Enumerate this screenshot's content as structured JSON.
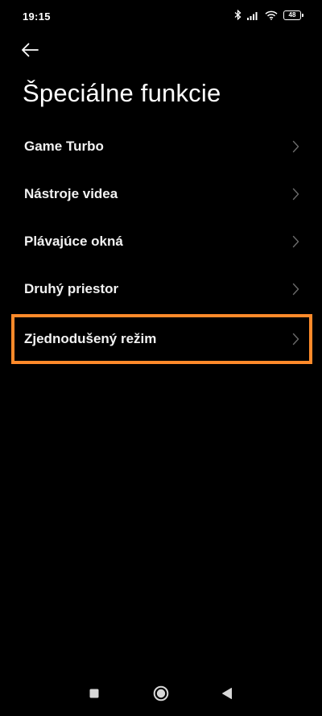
{
  "status_bar": {
    "time": "19:15",
    "battery_level": "48"
  },
  "header": {
    "back_icon": "arrow-left-icon",
    "title": "Špeciálne funkcie"
  },
  "settings": {
    "items": [
      {
        "label": "Game Turbo",
        "icon": "chevron-right-icon"
      },
      {
        "label": "Nástroje videa",
        "icon": "chevron-right-icon"
      },
      {
        "label": "Plávajúce okná",
        "icon": "chevron-right-icon"
      },
      {
        "label": "Druhý priestor",
        "icon": "chevron-right-icon"
      },
      {
        "label": "Zjednodušený režim",
        "icon": "chevron-right-icon",
        "highlighted": true
      }
    ]
  },
  "colors": {
    "background": "#000000",
    "text": "#ffffff",
    "highlight": "#ff8a2a",
    "chevron": "#6a6a6a"
  },
  "nav_bar": {
    "recents_icon": "square-icon",
    "home_icon": "circle-icon",
    "back_icon": "triangle-back-icon"
  }
}
